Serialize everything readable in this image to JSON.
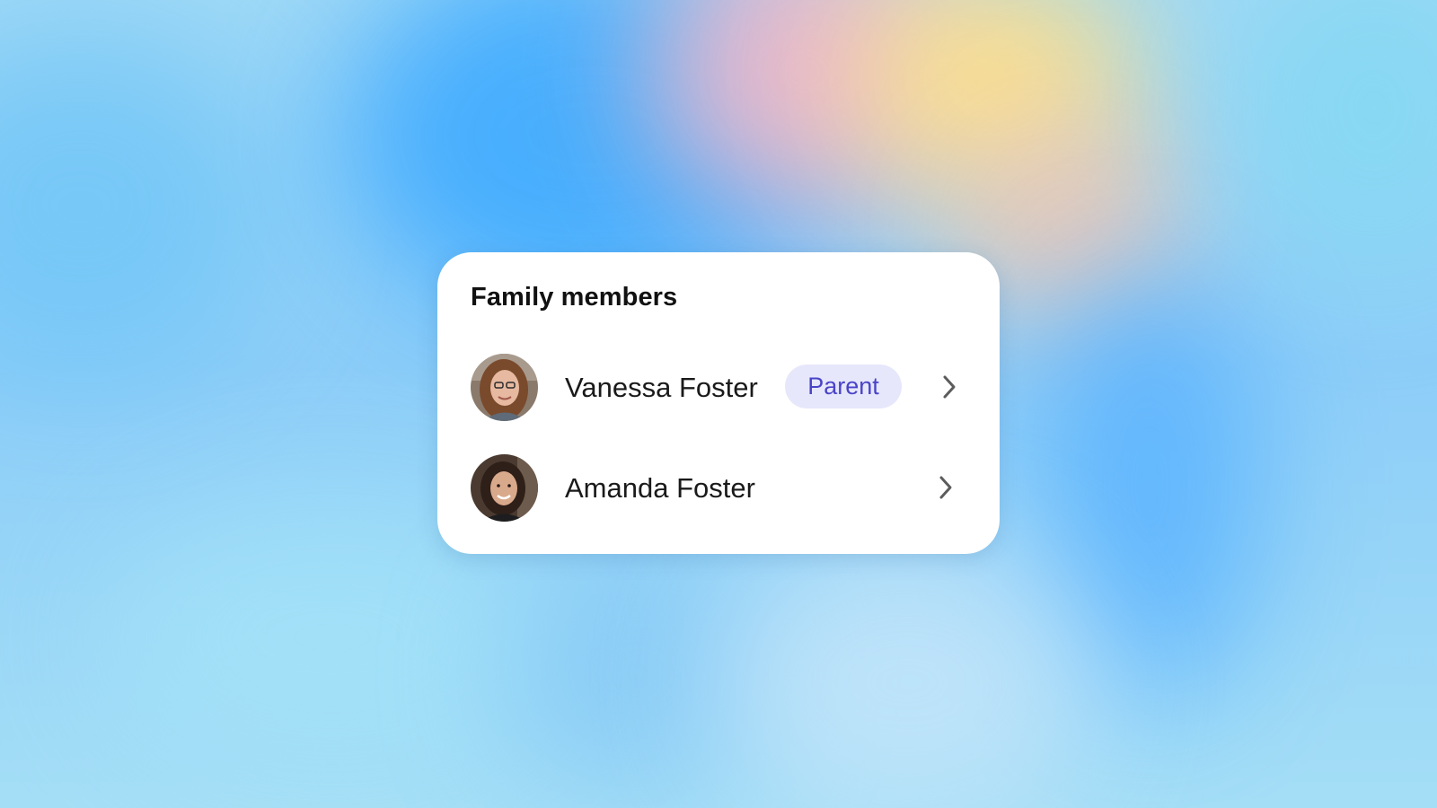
{
  "card": {
    "title": "Family members"
  },
  "members": [
    {
      "name": "Vanessa Foster",
      "role_badge": "Parent",
      "avatar": "avatar-photo-icon",
      "chevron": "chevron-right-icon"
    },
    {
      "name": "Amanda Foster",
      "avatar": "avatar-photo-icon",
      "chevron": "chevron-right-icon"
    }
  ],
  "colors": {
    "badge_background": "#e6e7fb",
    "badge_text": "#4a44c8",
    "card_background": "#ffffff",
    "title_text": "#111111"
  }
}
